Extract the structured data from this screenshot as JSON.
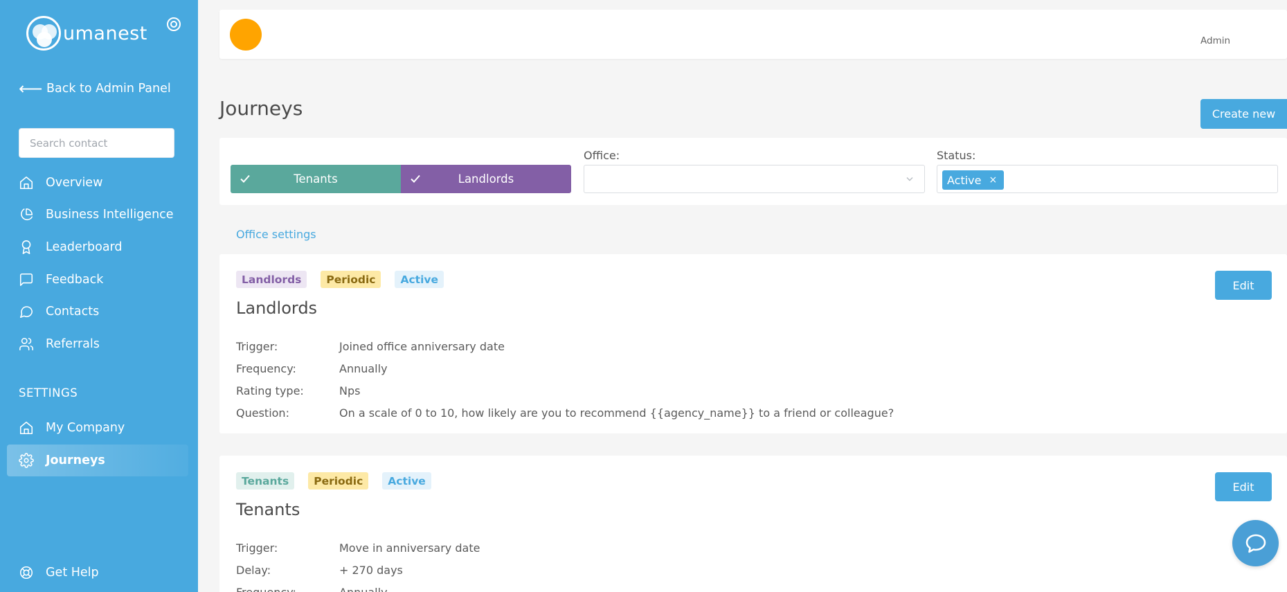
{
  "sidebar": {
    "brand": "umanest",
    "back_label": "Back to Admin Panel",
    "search_placeholder": "Search contact",
    "items": [
      {
        "label": "Overview",
        "icon": "home-icon"
      },
      {
        "label": "Business Intelligence",
        "icon": "pie-chart-icon"
      },
      {
        "label": "Leaderboard",
        "icon": "award-icon"
      },
      {
        "label": "Feedback",
        "icon": "message-square-icon"
      },
      {
        "label": "Contacts",
        "icon": "message-circle-icon"
      },
      {
        "label": "Referrals",
        "icon": "users-icon"
      }
    ],
    "settings_label": "SETTINGS",
    "settings_items": [
      {
        "label": "My Company",
        "icon": "home-icon"
      },
      {
        "label": "Journeys",
        "icon": "gear-icon",
        "active": true
      }
    ],
    "help_label": "Get Help"
  },
  "header": {
    "user_role": "Admin"
  },
  "page": {
    "title": "Journeys",
    "create_label": "Create new"
  },
  "filters": {
    "segments": [
      "Tenants",
      "Landlords"
    ],
    "office_label": "Office:",
    "office_value": "",
    "status_label": "Status:",
    "status_chip": "Active",
    "status_chip_remove": "×"
  },
  "office_settings_label": "Office settings",
  "journeys": [
    {
      "tags": [
        "Landlords",
        "Periodic",
        "Active"
      ],
      "title": "Landlords",
      "edit_label": "Edit",
      "rows": [
        {
          "k": "Trigger:",
          "v": "Joined office anniversary date"
        },
        {
          "k": "Frequency:",
          "v": "Annually"
        },
        {
          "k": "Rating type:",
          "v": "Nps"
        },
        {
          "k": "Question:",
          "v": "On a scale of 0 to 10, how likely are you to recommend {{agency_name}} to a friend or colleague?"
        }
      ]
    },
    {
      "tags": [
        "Tenants",
        "Periodic",
        "Active"
      ],
      "title": "Tenants",
      "edit_label": "Edit",
      "rows": [
        {
          "k": "Trigger:",
          "v": "Move in anniversary date"
        },
        {
          "k": "Delay:",
          "v": "+ 270 days"
        },
        {
          "k": "Frequency:",
          "v": "Annually"
        }
      ]
    }
  ],
  "colors": {
    "sidebar": "#48a9df",
    "tenants": "#5aa89c",
    "landlords": "#835fa6",
    "avatar": "#ffa400",
    "accent": "#48a9df"
  }
}
